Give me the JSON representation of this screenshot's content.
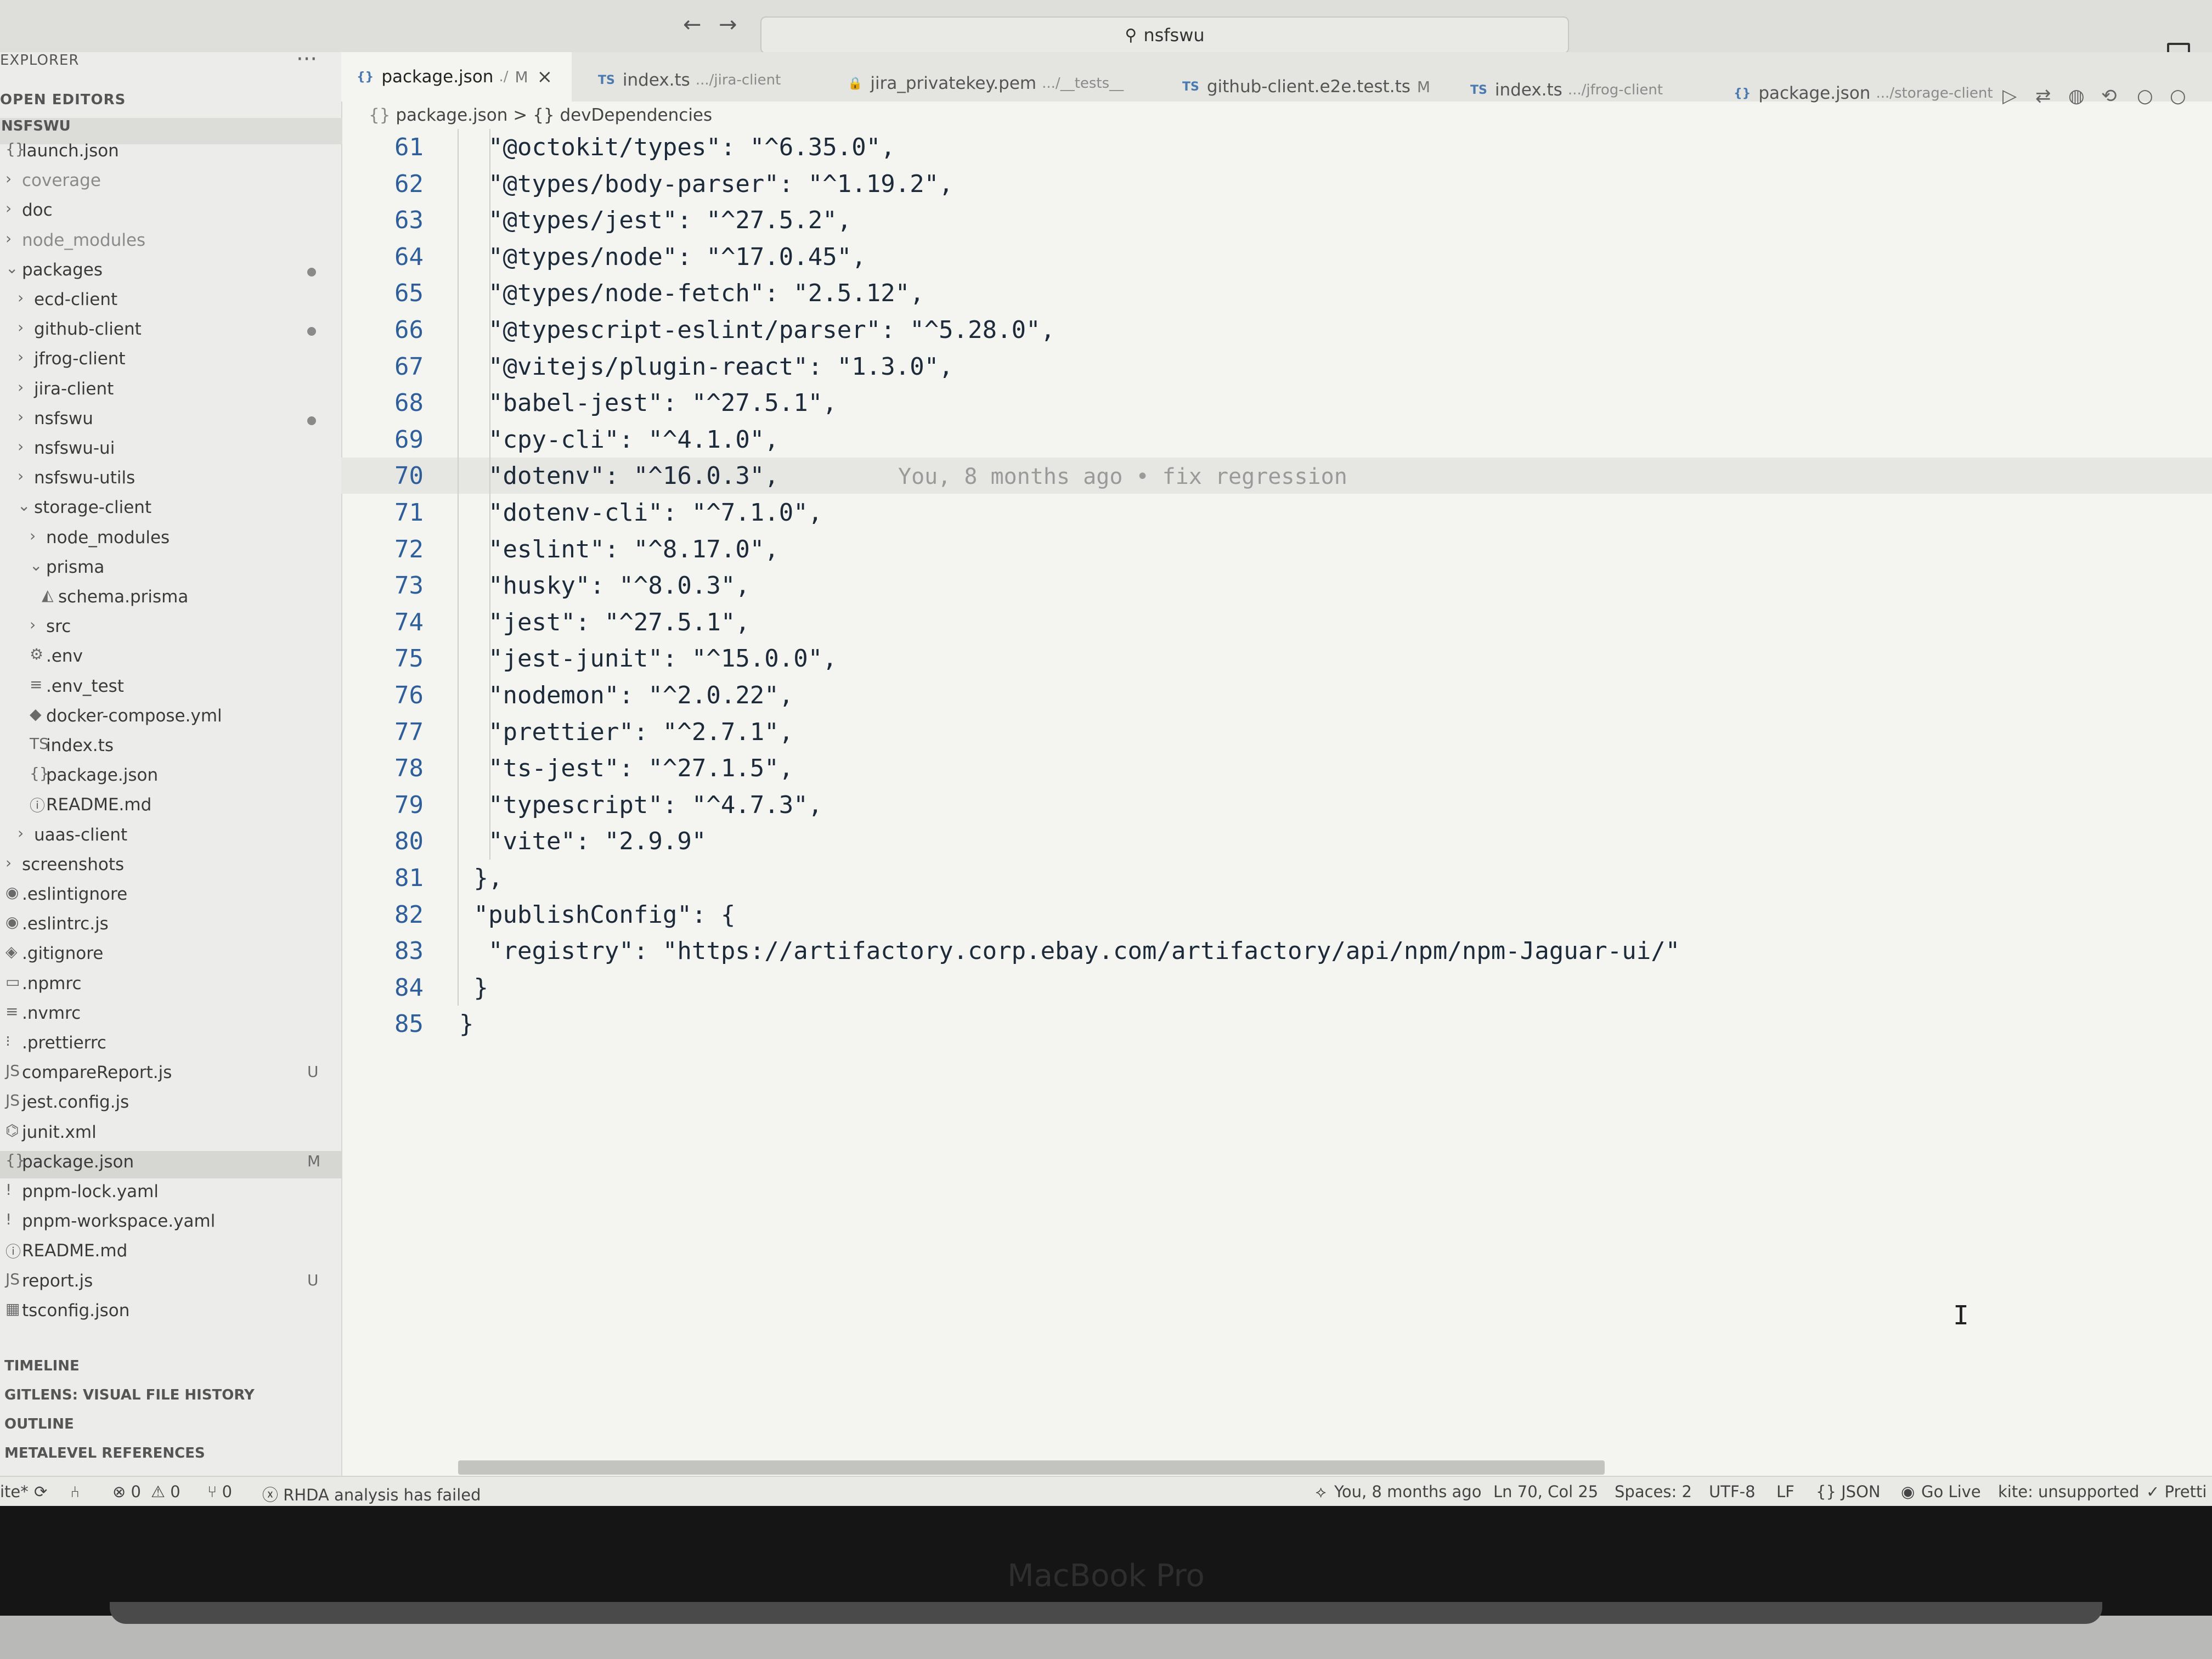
{
  "titlebar": {
    "search_text": "nsfswu",
    "back_icon": "←",
    "forward_icon": "→"
  },
  "sidebar": {
    "explorer_title": "EXPLORER",
    "more_label": "···",
    "open_editors": "OPEN EDITORS",
    "workspace": "NSFSWU",
    "items": [
      {
        "label": "launch.json",
        "icon": "{}",
        "badge": ""
      },
      {
        "label": "coverage",
        "icon": "›",
        "badge": ""
      },
      {
        "label": "doc",
        "icon": "›",
        "badge": ""
      },
      {
        "label": "node_modules",
        "icon": "›",
        "badge": ""
      },
      {
        "label": "packages",
        "icon": "⌄",
        "badge": "dot"
      },
      {
        "label": "ecd-client",
        "icon": "›",
        "badge": ""
      },
      {
        "label": "github-client",
        "icon": "›",
        "badge": "dot"
      },
      {
        "label": "jfrog-client",
        "icon": "›",
        "badge": ""
      },
      {
        "label": "jira-client",
        "icon": "›",
        "badge": ""
      },
      {
        "label": "nsfswu",
        "icon": "›",
        "badge": "dot"
      },
      {
        "label": "nsfswu-ui",
        "icon": "›",
        "badge": ""
      },
      {
        "label": "nsfswu-utils",
        "icon": "›",
        "badge": ""
      },
      {
        "label": "storage-client",
        "icon": "⌄",
        "badge": ""
      },
      {
        "label": "node_modules",
        "icon": "›",
        "badge": ""
      },
      {
        "label": "prisma",
        "icon": "⌄",
        "badge": ""
      },
      {
        "label": "schema.prisma",
        "icon": "◭",
        "badge": ""
      },
      {
        "label": "src",
        "icon": "›",
        "badge": ""
      },
      {
        "label": ".env",
        "icon": "⚙",
        "badge": ""
      },
      {
        "label": ".env_test",
        "icon": "≡",
        "badge": ""
      },
      {
        "label": "docker-compose.yml",
        "icon": "◆",
        "badge": ""
      },
      {
        "label": "index.ts",
        "icon": "TS",
        "badge": ""
      },
      {
        "label": "package.json",
        "icon": "{}",
        "badge": ""
      },
      {
        "label": "README.md",
        "icon": "ⓘ",
        "badge": ""
      },
      {
        "label": "uaas-client",
        "icon": "›",
        "badge": ""
      },
      {
        "label": "screenshots",
        "icon": "›",
        "badge": ""
      },
      {
        "label": ".eslintignore",
        "icon": "◉",
        "badge": ""
      },
      {
        "label": ".eslintrc.js",
        "icon": "◉",
        "badge": ""
      },
      {
        "label": ".gitignore",
        "icon": "◈",
        "badge": ""
      },
      {
        "label": ".npmrc",
        "icon": "▭",
        "badge": ""
      },
      {
        "label": ".nvmrc",
        "icon": "≡",
        "badge": ""
      },
      {
        "label": ".prettierrc",
        "icon": "⁝",
        "badge": ""
      },
      {
        "label": "compareReport.js",
        "icon": "JS",
        "badge": "U"
      },
      {
        "label": "jest.config.js",
        "icon": "JS",
        "badge": ""
      },
      {
        "label": "junit.xml",
        "icon": "⌬",
        "badge": ""
      },
      {
        "label": "package.json",
        "icon": "{}",
        "badge": "M"
      },
      {
        "label": "pnpm-lock.yaml",
        "icon": "!",
        "badge": ""
      },
      {
        "label": "pnpm-workspace.yaml",
        "icon": "!",
        "badge": ""
      },
      {
        "label": "README.md",
        "icon": "ⓘ",
        "badge": ""
      },
      {
        "label": "report.js",
        "icon": "JS",
        "badge": "U"
      },
      {
        "label": "tsconfig.json",
        "icon": "▦",
        "badge": ""
      }
    ],
    "sections": [
      "TIMELINE",
      "GITLENS: VISUAL FILE HISTORY",
      "OUTLINE",
      "METALEVEL REFERENCES"
    ]
  },
  "tabs": [
    {
      "icon": "{}",
      "label": "package.json",
      "sub": "./",
      "mod": "M",
      "active": true
    },
    {
      "icon": "TS",
      "label": "index.ts",
      "sub": ".../jira-client",
      "mod": "",
      "active": false
    },
    {
      "icon": "🔒",
      "label": "jira_privatekey.pem",
      "sub": ".../__tests__",
      "mod": "",
      "active": false
    },
    {
      "icon": "TS",
      "label": "github-client.e2e.test.ts",
      "sub": "",
      "mod": "M",
      "active": false
    },
    {
      "icon": "TS",
      "label": "index.ts",
      "sub": ".../jfrog-client",
      "mod": "",
      "active": false
    },
    {
      "icon": "{}",
      "label": "package.json",
      "sub": ".../storage-client",
      "mod": "",
      "active": false
    }
  ],
  "breadcrumb": {
    "file": "package.json",
    "sep": ">",
    "symbol": "devDependencies"
  },
  "editor": {
    "lines": [
      {
        "n": "61",
        "text": "  \"@octokit/types\": \"^6.35.0\","
      },
      {
        "n": "62",
        "text": "  \"@types/body-parser\": \"^1.19.2\","
      },
      {
        "n": "63",
        "text": "  \"@types/jest\": \"^27.5.2\","
      },
      {
        "n": "64",
        "text": "  \"@types/node\": \"^17.0.45\","
      },
      {
        "n": "65",
        "text": "  \"@types/node-fetch\": \"2.5.12\","
      },
      {
        "n": "66",
        "text": "  \"@typescript-eslint/parser\": \"^5.28.0\","
      },
      {
        "n": "67",
        "text": "  \"@vitejs/plugin-react\": \"1.3.0\","
      },
      {
        "n": "68",
        "text": "  \"babel-jest\": \"^27.5.1\","
      },
      {
        "n": "69",
        "text": "  \"cpy-cli\": \"^4.1.0\","
      },
      {
        "n": "70",
        "text": "  \"dotenv\": \"^16.0.3\","
      },
      {
        "n": "71",
        "text": "  \"dotenv-cli\": \"^7.1.0\","
      },
      {
        "n": "72",
        "text": "  \"eslint\": \"^8.17.0\","
      },
      {
        "n": "73",
        "text": "  \"husky\": \"^8.0.3\","
      },
      {
        "n": "74",
        "text": "  \"jest\": \"^27.5.1\","
      },
      {
        "n": "75",
        "text": "  \"jest-junit\": \"^15.0.0\","
      },
      {
        "n": "76",
        "text": "  \"nodemon\": \"^2.0.22\","
      },
      {
        "n": "77",
        "text": "  \"prettier\": \"^2.7.1\","
      },
      {
        "n": "78",
        "text": "  \"ts-jest\": \"^27.1.5\","
      },
      {
        "n": "79",
        "text": "  \"typescript\": \"^4.7.3\","
      },
      {
        "n": "80",
        "text": "  \"vite\": \"2.9.9\""
      },
      {
        "n": "81",
        "text": " },"
      },
      {
        "n": "82",
        "text": " \"publishConfig\": {"
      },
      {
        "n": "83",
        "text": "  \"registry\": \"https://artifactory.corp.ebay.com/artifactory/api/npm/npm-Jaguar-ui/\""
      },
      {
        "n": "84",
        "text": " }"
      },
      {
        "n": "85",
        "text": "}"
      }
    ],
    "blame_line": "70",
    "blame_text": "You, 8 months ago • fix regression"
  },
  "statusbar": {
    "branch": "ite*",
    "errors": "⊗ 0",
    "warnings": "⚠ 0",
    "ports": "⑂ 0",
    "rhda": "ⓧ RHDA analysis has failed",
    "blame": "You, 8 months ago",
    "position": "Ln 70, Col 25",
    "spaces": "Spaces: 2",
    "encoding": "UTF-8",
    "eol": "LF",
    "language": "{} JSON",
    "golive": "Go Live",
    "kite": "kite: unsupported",
    "prettier": "✓ Pretti"
  },
  "bezel": {
    "brand": "MacBook Pro"
  }
}
